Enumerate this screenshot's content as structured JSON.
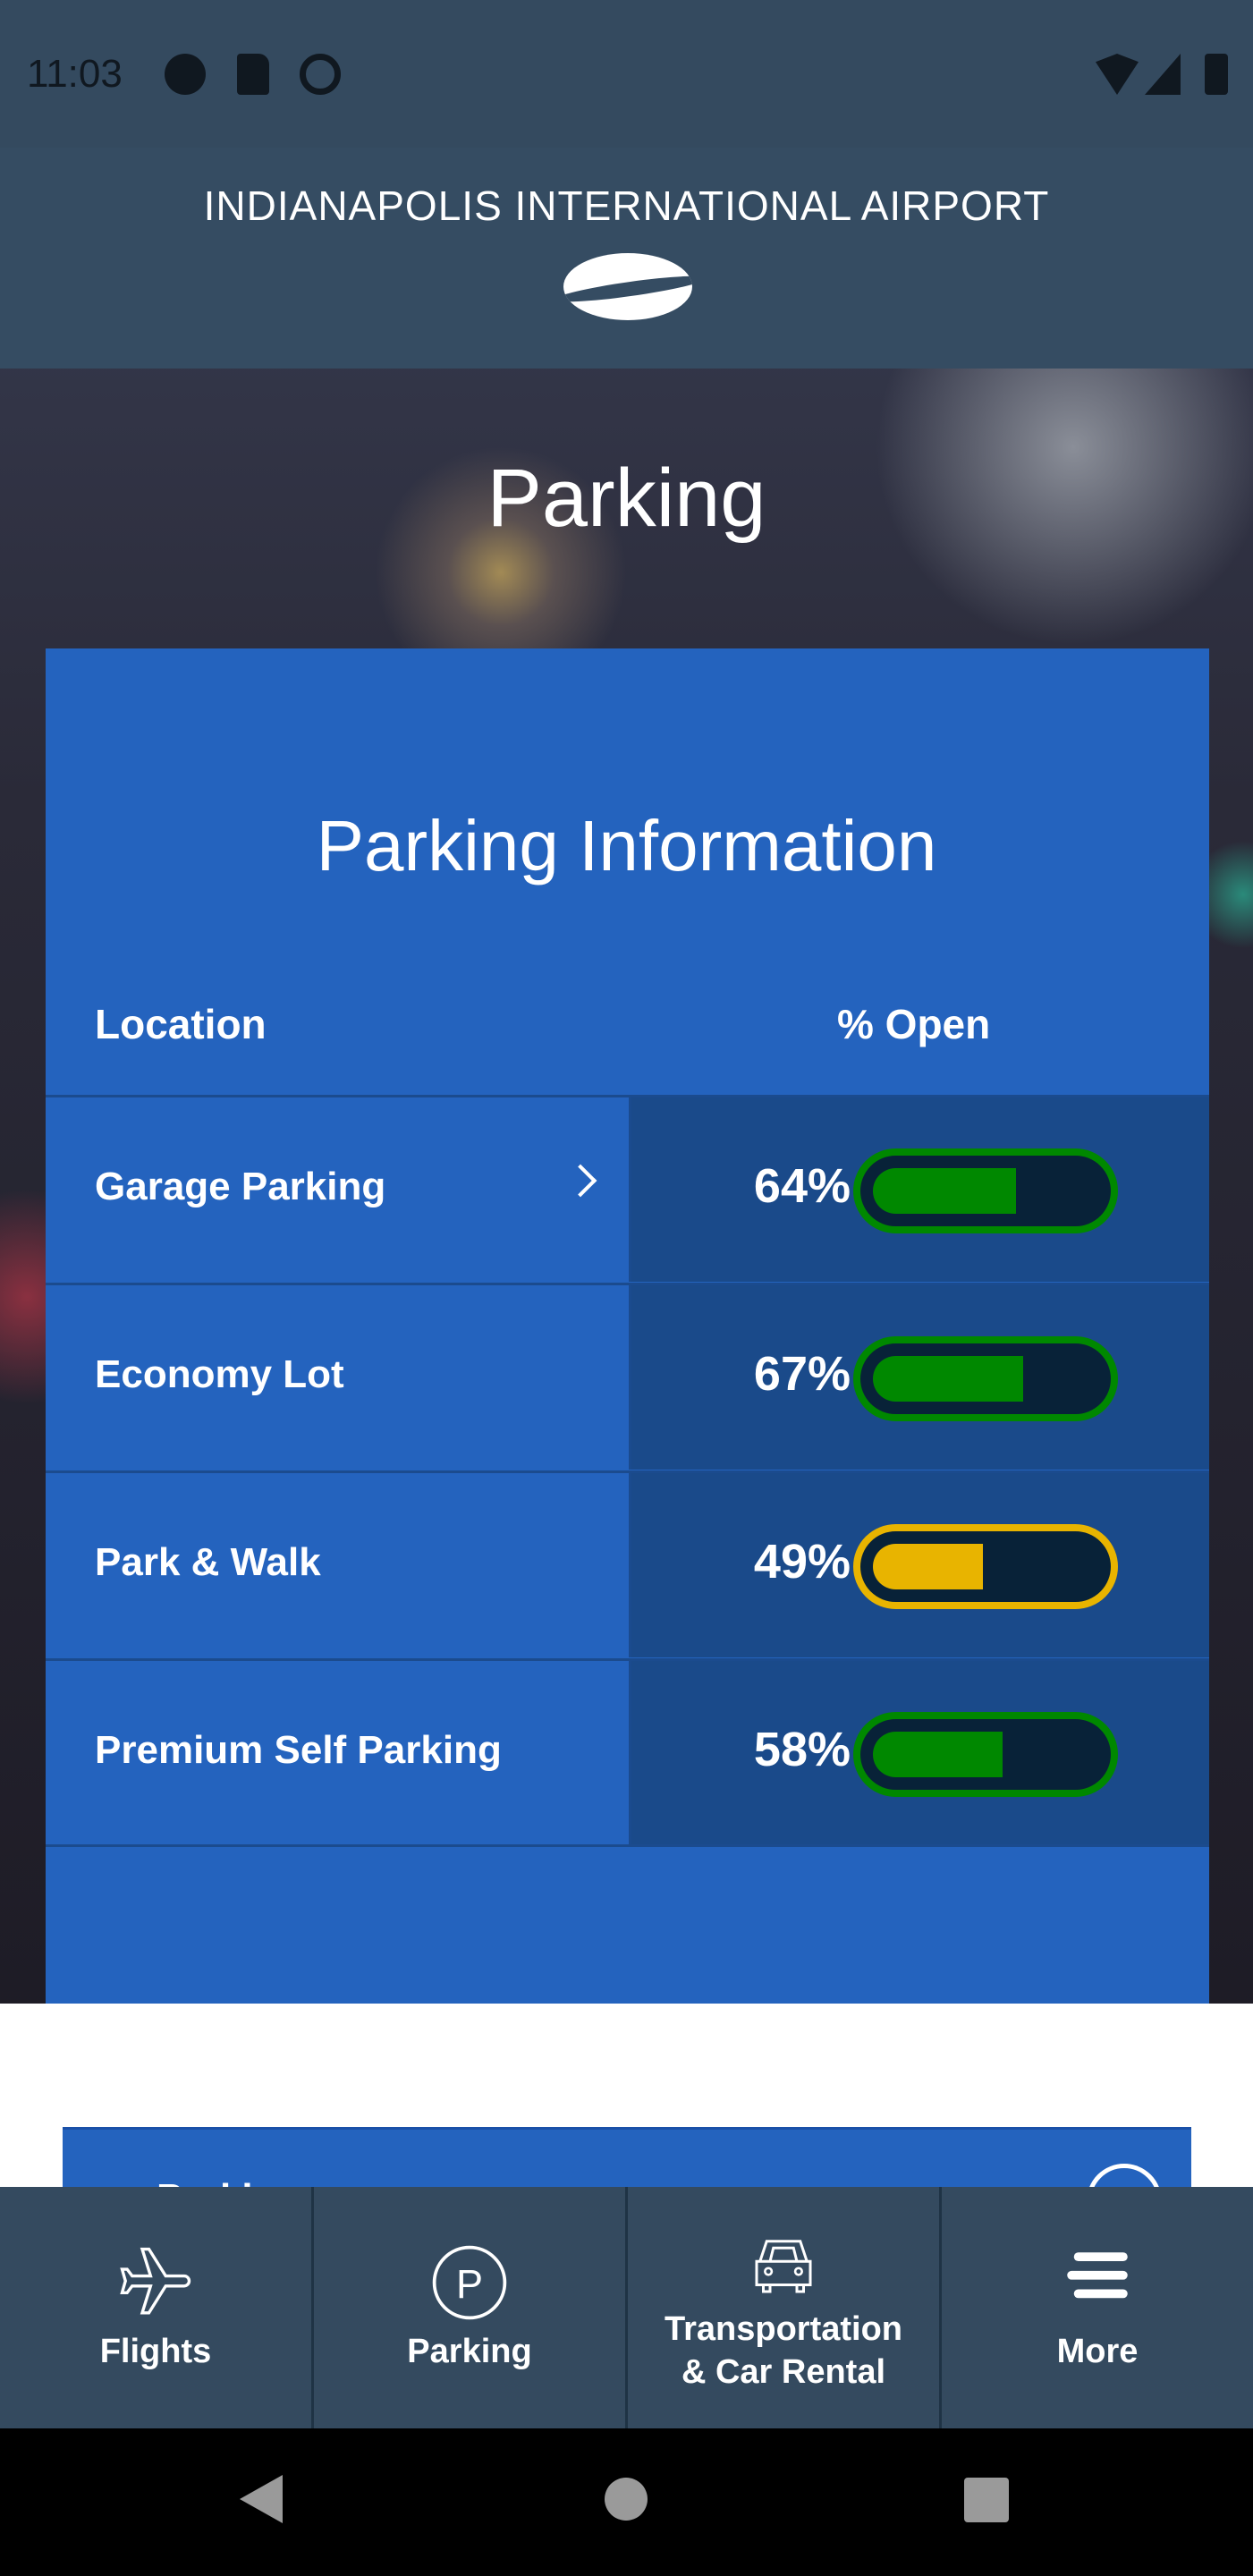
{
  "status_bar": {
    "time": "11:03",
    "icons": [
      "assistant-icon",
      "sd-card-icon",
      "do-not-disturb-icon",
      "wifi-icon",
      "signal-icon",
      "battery-icon"
    ]
  },
  "header": {
    "brand": "INDIANAPOLIS INTERNATIONAL AIRPORT",
    "logo": "airport-logo"
  },
  "page": {
    "title": "Parking"
  },
  "card": {
    "title": "Parking Information",
    "col_location": "Location",
    "col_open": "% Open",
    "rows": [
      {
        "name": "Garage Parking",
        "pct_label": "64%",
        "pct": 64,
        "color": "#008800",
        "has_chevron": true
      },
      {
        "name": "Economy Lot",
        "pct_label": "67%",
        "pct": 67,
        "color": "#008800",
        "has_chevron": false
      },
      {
        "name": "Park & Walk",
        "pct_label": "49%",
        "pct": 49,
        "color": "#e8b400",
        "has_chevron": false
      },
      {
        "name": "Premium Self Parking",
        "pct_label": "58%",
        "pct": 58,
        "color": "#008800",
        "has_chevron": false
      }
    ]
  },
  "panel2": {
    "title": "Parking"
  },
  "bottom_nav": [
    {
      "label": "Flights",
      "icon": "airplane-icon"
    },
    {
      "label": "Parking",
      "icon": "parking-icon"
    },
    {
      "label": "Transportation & Car Rental",
      "line1": "Transportation",
      "line2": "& Car Rental",
      "icon": "car-icon"
    },
    {
      "label": "More",
      "icon": "menu-icon"
    }
  ],
  "colors": {
    "card": "#2463be",
    "value_col": "#1a4a8a",
    "nav": "#344a5f",
    "green": "#008800",
    "yellow": "#e8b400"
  }
}
